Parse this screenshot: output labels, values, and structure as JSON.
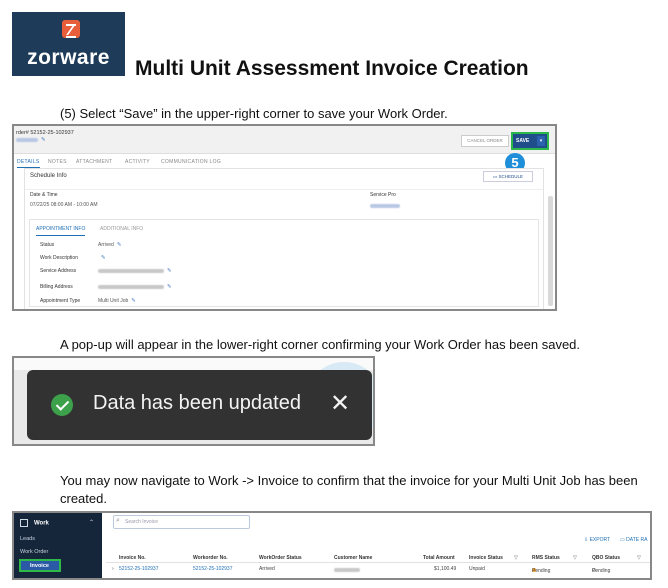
{
  "logo": {
    "wordmark": "zorware"
  },
  "doc_title": "Multi Unit Assessment Invoice Creation",
  "instructions": {
    "step5": "(5) Select “Save” in the upper-right corner to save your Work Order.",
    "popup": "A pop-up will appear in the lower-right corner confirming your Work Order has been saved.",
    "navigate": "You may now navigate to Work -> Invoice to confirm that the invoice for your Multi Unit Job has been created."
  },
  "work_order": {
    "number": "rder# 52152-25-102937",
    "cancel_label": "CANCEL ORDER",
    "save_label": "SAVE",
    "save_caret": "▾",
    "step_badge": "5",
    "tabs": [
      "DETAILS",
      "NOTES",
      "ATTACHMENT",
      "ACTIVITY",
      "COMMUNICATION LOG"
    ],
    "schedule_title": "Schedule Info",
    "schedule_button": "SCHEDULE",
    "date_time_header": "Date & Time",
    "service_pro_header": "Service Pro",
    "date_time_value": "07/22/25 08:00 AM - 10:00 AM",
    "appointment_tab": "APPOINTMENT INFO",
    "additional_tab": "ADDITIONAL INFO",
    "fields": {
      "status_label": "Status",
      "status_value": "Arrived",
      "work_desc_label": "Work Description",
      "service_address_label": "Service Address",
      "billing_address_label": "Billing Address",
      "appointment_type_label": "Appointment Type",
      "appointment_type_value": "Multi Unit Job"
    }
  },
  "toast": {
    "message": "Data has been updated",
    "close": "✕"
  },
  "invoice_list": {
    "sidebar": {
      "section": "Work",
      "items": [
        "Leads",
        "Work Order",
        "Invoice"
      ]
    },
    "search_placeholder": "Search Invoice",
    "export_label": "EXPORT",
    "date_range_label": "DATE RA",
    "columns": [
      "Invoice No.",
      "Workorder No.",
      "WorkOrder Status",
      "Customer Name",
      "Total Amount",
      "Invoice Status",
      "RMS Status",
      "QBO Status"
    ],
    "filter_glyph": "▽",
    "row": {
      "invoice_no": "52152-25-102937",
      "workorder_no": "52152-25-102937",
      "workorder_status": "Arrived",
      "total_amount": "$1,100.49",
      "invoice_status": "Unpaid",
      "rms_status": "Pending",
      "qbo_status": "Pending"
    }
  },
  "colors": {
    "logo_bg": "#1e3c5a",
    "logo_mark": "#e85d3a",
    "highlight": "#2db84a",
    "primary": "#1f4e8a",
    "toast_bg": "#323232",
    "success": "#3da14b"
  }
}
